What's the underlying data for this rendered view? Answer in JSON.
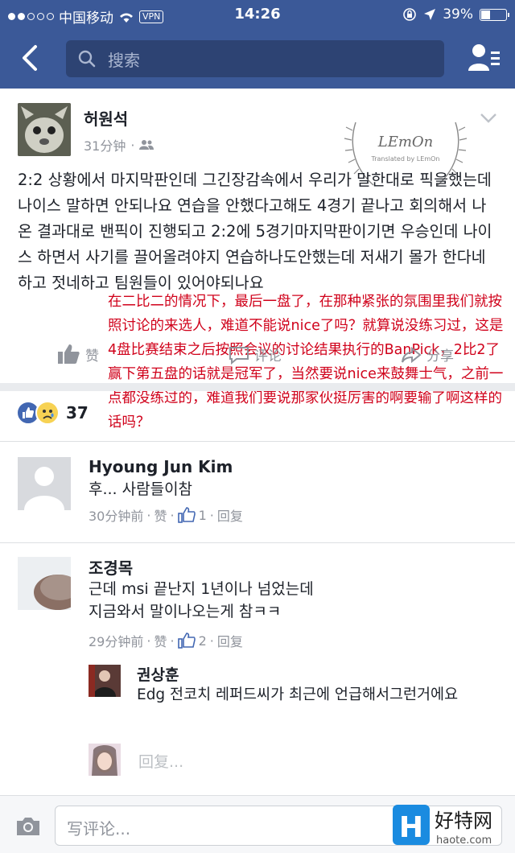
{
  "status_bar": {
    "carrier": "中国移动",
    "vpn": "VPN",
    "time": "14:26",
    "battery": "39%",
    "battery_level": 0.39
  },
  "nav": {
    "search_placeholder": "搜索"
  },
  "post": {
    "author": "허원석",
    "time": "31分钟",
    "body": "2:2 상황에서 마지막판인데 그긴장감속에서 우리가 말한대로 픽을했는데 나이스 말하면 안되나요 연습을 안했다고해도 4경기 끝나고 회의해서 나온 결과대로 밴픽이 진행되고 2:2에 5경기마지막판이기면 우승인데 나이스 하면서 사기를 끌어올려야지 연습하나도안했는데 저새기 몰가 한다네 하고 젓네하고 팀원들이 있어야되나요",
    "watermark_title": "LEmOn",
    "watermark_sub": "Translated by LEmOn",
    "translation": "在二比二的情况下，最后一盘了，在那种紧张的氛围里我们就按照讨论的来选人，难道不能说nice了吗？就算说没练习过，这是4盘比赛结束之后按照会议的讨论结果执行的BanPick，2比2了赢下第五盘的话就是冠军了，当然要说nice来鼓舞士气，之前一点都没练过的，难道我们要说那家伙挺厉害的啊要输了啊这样的话吗？",
    "actions": {
      "like": "赞",
      "comment": "评论",
      "share": "分享"
    },
    "reaction_count": "37"
  },
  "comments": [
    {
      "name": "Hyoung Jun Kim",
      "text": "후... 사람들이참",
      "time": "30分钟前",
      "like": "赞",
      "likes": "1",
      "reply": "回复"
    },
    {
      "name": "조경목",
      "text_line1": "근데 msi 끝난지 1년이나 넘었는데",
      "text_line2": "지금와서 말이나오는게 참ㅋㅋ",
      "time": "29分钟前",
      "like": "赞",
      "likes": "2",
      "reply": "回复"
    }
  ],
  "reply": {
    "name": "권상훈",
    "text": "Edg 전코치 레퍼드씨가 최근에 언급해서그런거에요"
  },
  "reply_placeholder": "回复...",
  "composer_placeholder": "写评论...",
  "logo": {
    "text": "好特网",
    "url": "haote.com",
    "letter": "H"
  },
  "colors": {
    "brand": "#3b5998",
    "overlay_text": "#d0021b"
  }
}
